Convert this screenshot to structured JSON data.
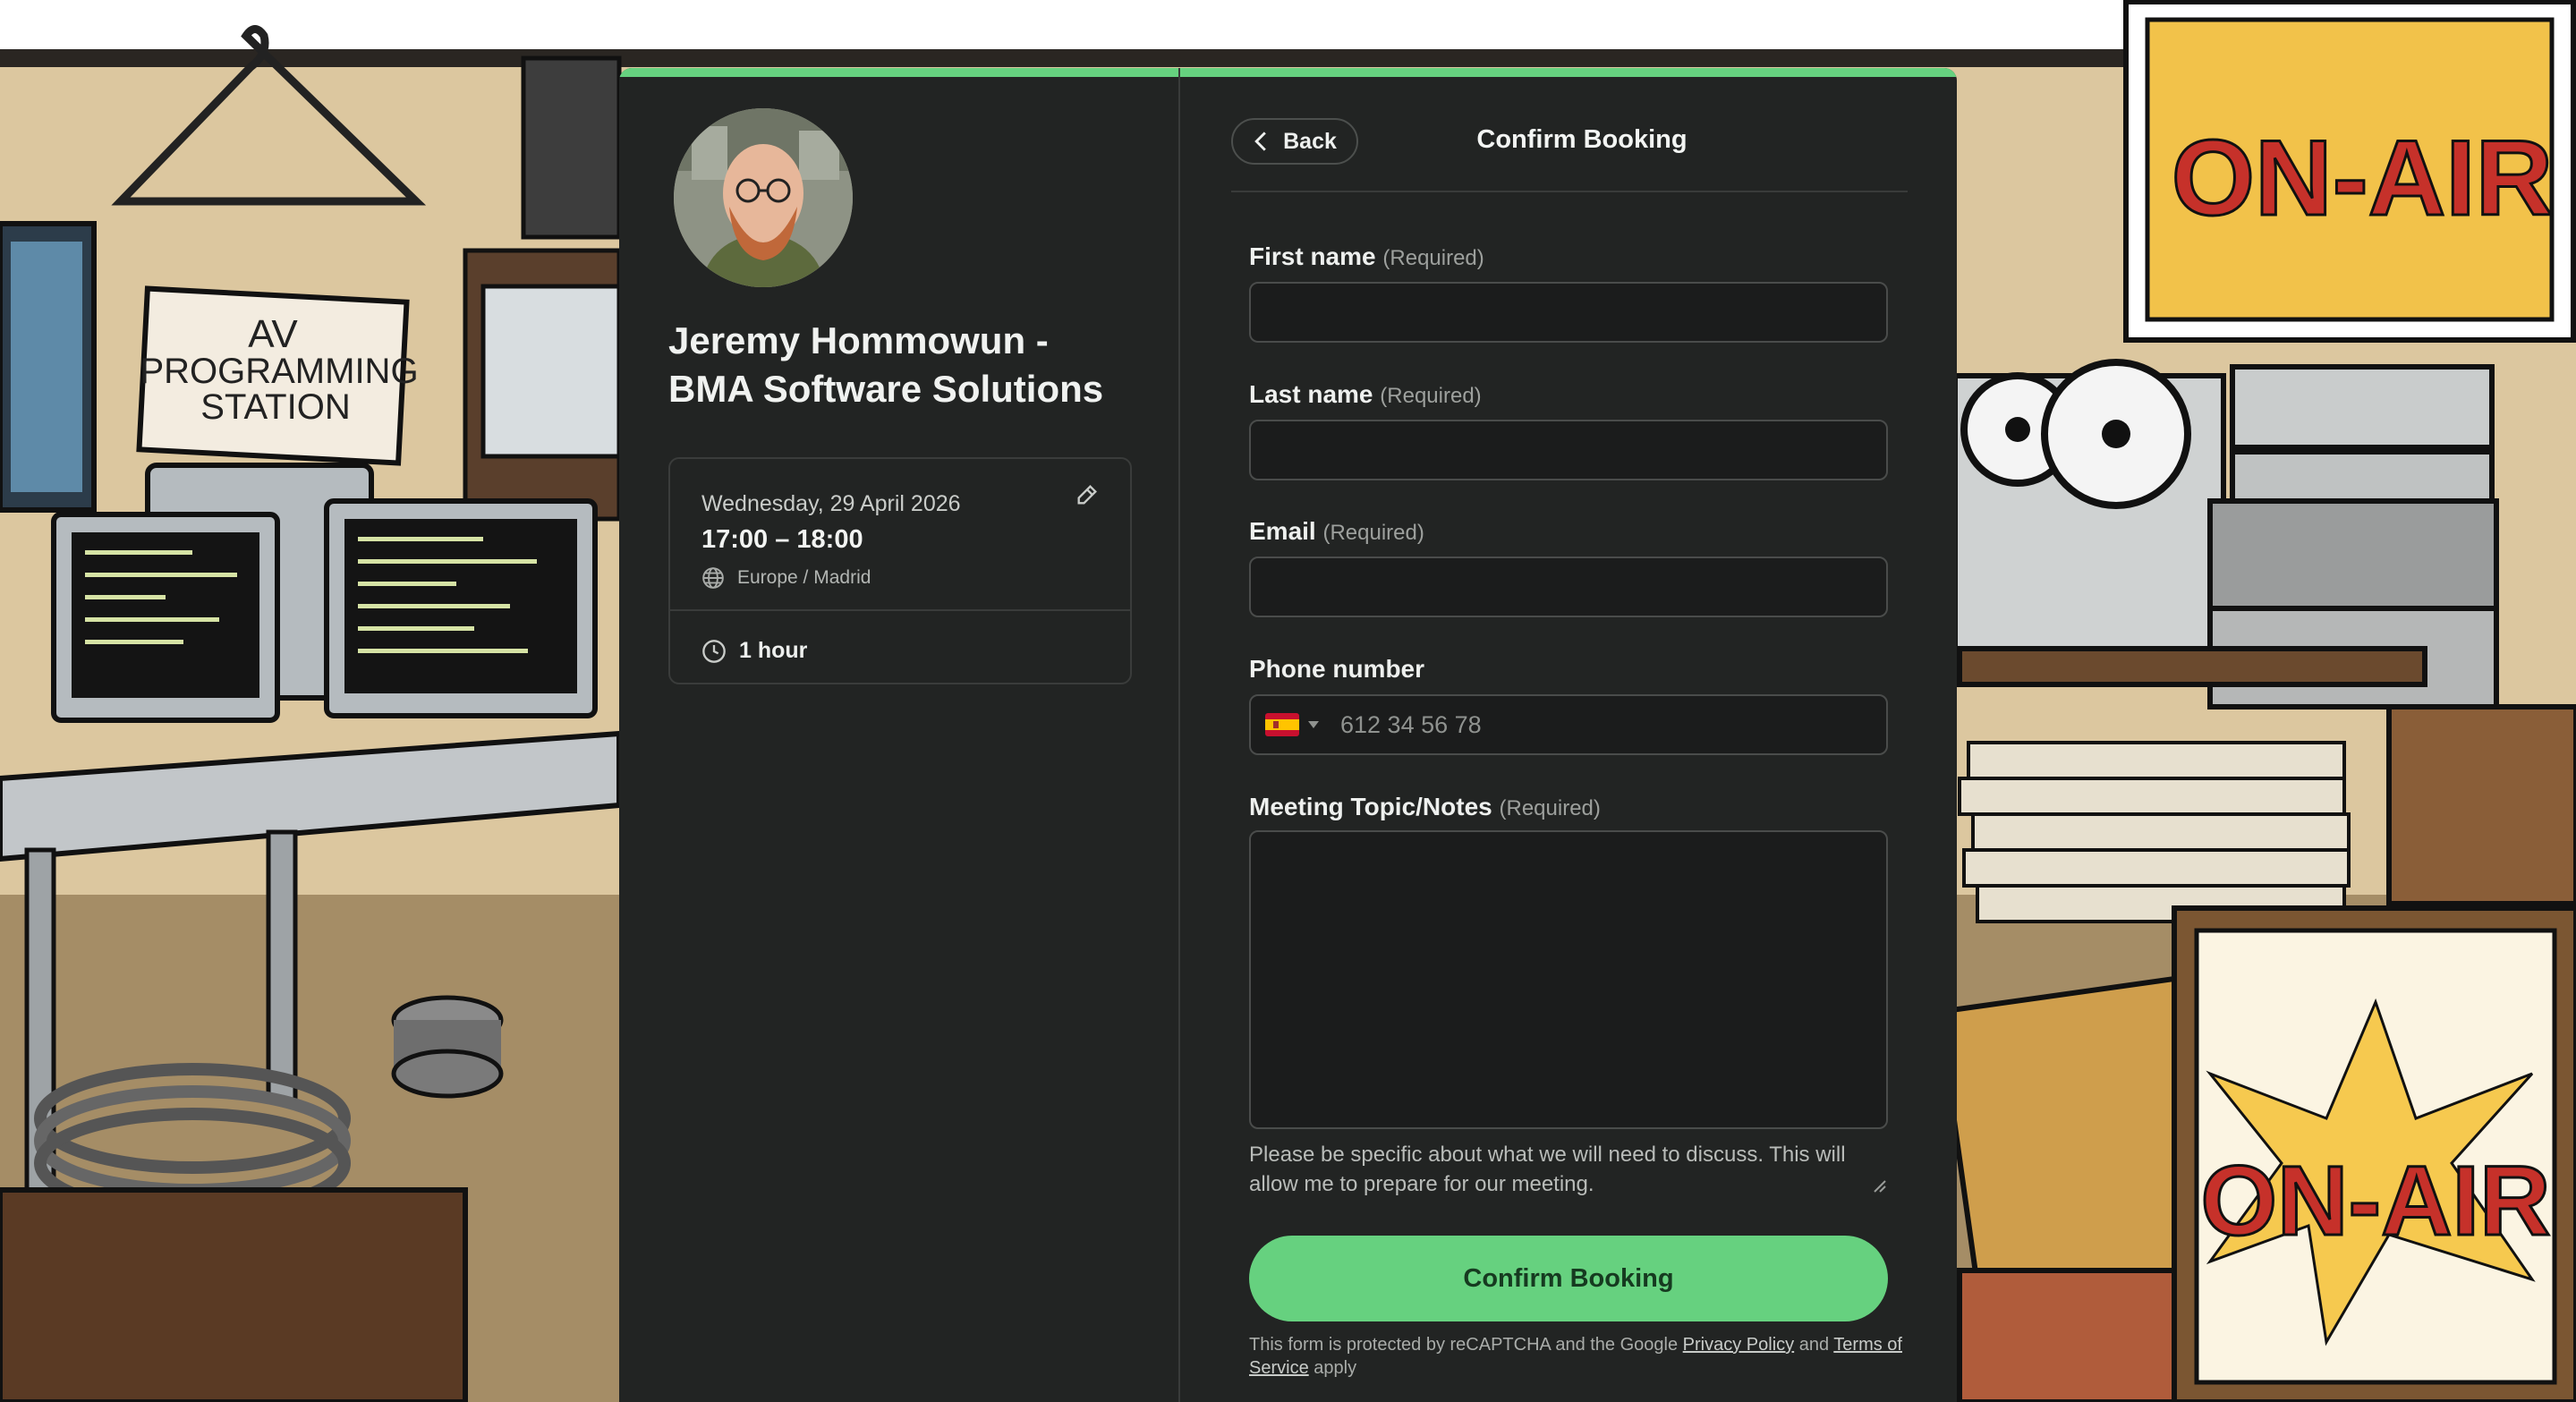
{
  "host": {
    "name_line1": "Jeremy Hommowun -",
    "name_line2": "BMA Software Solutions"
  },
  "booking": {
    "date": "Wednesday, 29 April 2026",
    "time": "17:00 – 18:00",
    "timezone": "Europe / Madrid",
    "duration": "1 hour"
  },
  "header": {
    "back_label": "Back",
    "title": "Confirm Booking"
  },
  "form": {
    "required_tag": "(Required)",
    "first_name": {
      "label": "First name",
      "value": ""
    },
    "last_name": {
      "label": "Last name",
      "value": ""
    },
    "email": {
      "label": "Email",
      "value": ""
    },
    "phone": {
      "label": "Phone number",
      "placeholder": "612 34 56 78",
      "country": "ES"
    },
    "notes": {
      "label": "Meeting Topic/Notes",
      "value": "",
      "help": "Please be specific about what we will need to discuss. This will allow me to prepare for our meeting."
    },
    "submit_label": "Confirm Booking"
  },
  "legal": {
    "prefix": "This form is protected by reCAPTCHA and the Google",
    "privacy_link": "Privacy Policy",
    "and": "and",
    "terms_link": "Terms of Service",
    "suffix": "apply"
  },
  "background": {
    "sign_station_line1": "AV",
    "sign_station_line2": "PROGRAMMING",
    "sign_station_line3": "STATION",
    "sign_onair_top": "ON-AIR",
    "sign_onair_bottom": "ON-AIR"
  },
  "colors": {
    "accent": "#66d17f",
    "card_bg": "#222423",
    "input_bg": "#1b1c1c"
  },
  "icons": {
    "back": "chevron-left-icon",
    "edit": "pencil-icon",
    "timezone": "globe-icon",
    "duration": "clock-icon",
    "country": "spain-flag-icon"
  }
}
